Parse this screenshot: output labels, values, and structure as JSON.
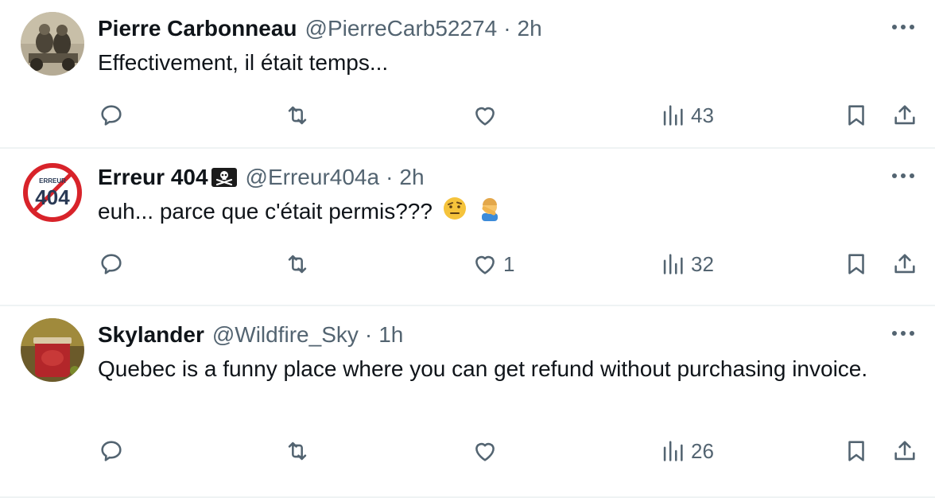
{
  "tweets": [
    {
      "name": "Pierre Carbonneau",
      "handle": "@PierreCarb52274",
      "separator": "·",
      "time": "2h",
      "text": "Effectivement, il était temps...",
      "replies": "",
      "retweets": "",
      "likes": "",
      "views": "43"
    },
    {
      "name": "Erreur 404",
      "badge": "skull-crossbones-flag",
      "handle": "@Erreur404a",
      "separator": "·",
      "time": "2h",
      "text": "euh... parce que c'était permis???",
      "emojis": [
        "face-with-raised-eyebrow",
        "person-facepalming"
      ],
      "replies": "",
      "retweets": "",
      "likes": "1",
      "views": "32",
      "avatar_logo_text": [
        "ERREUR",
        "404"
      ]
    },
    {
      "name": "Skylander",
      "handle": "@Wildfire_Sky",
      "separator": "·",
      "time": "1h",
      "text": "Quebec is a funny place where you can get refund without purchasing invoice.",
      "replies": "",
      "retweets": "",
      "likes": "",
      "views": "26"
    }
  ],
  "colors": {
    "text": "#0f1419",
    "secondary": "#536471",
    "divider": "#eff3f4",
    "logo_red": "#d8232a"
  }
}
